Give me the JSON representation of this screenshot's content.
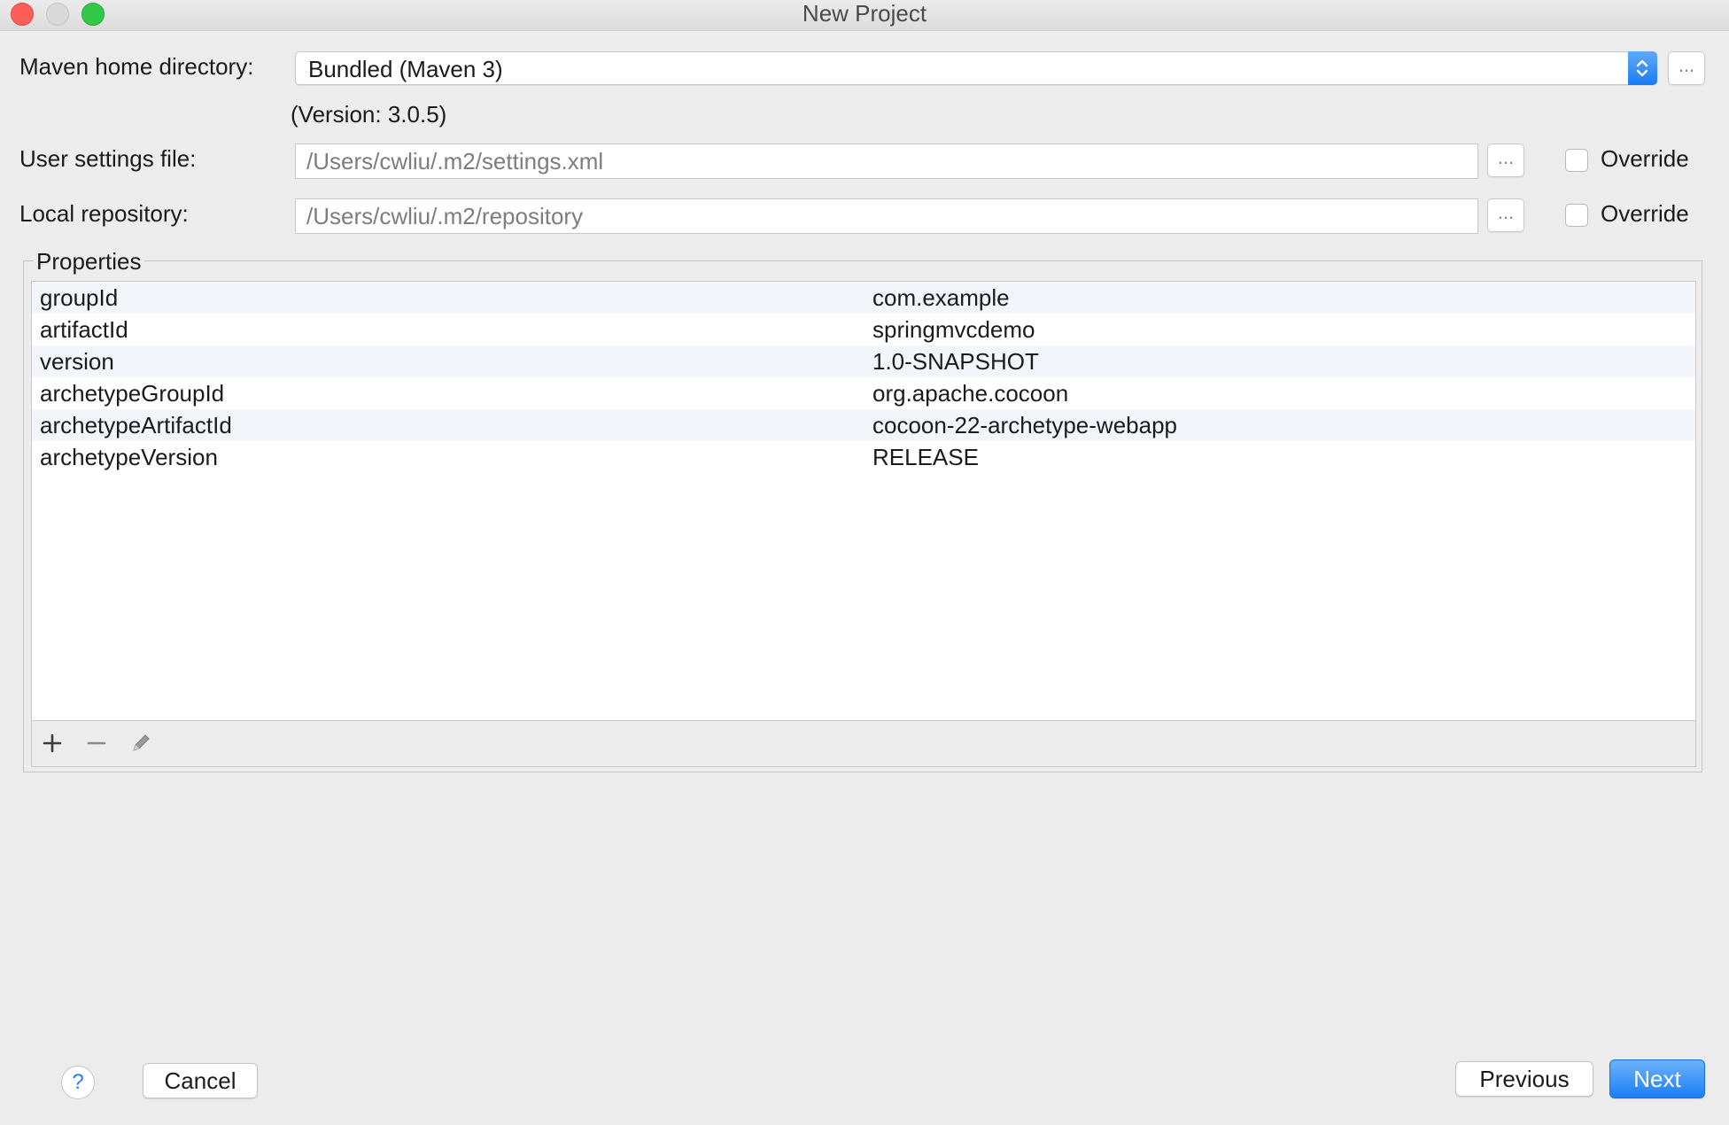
{
  "window": {
    "title": "New Project",
    "controls": [
      "close",
      "minimize",
      "zoom"
    ]
  },
  "maven": {
    "home_label": "Maven home directory:",
    "home_value": "Bundled (Maven 3)",
    "version_text": "(Version: 3.0.5)",
    "browse_label": "..."
  },
  "user_settings": {
    "label": "User settings file:",
    "value": "/Users/cwliu/.m2/settings.xml",
    "browse_label": "...",
    "override_label": "Override",
    "override_checked": false
  },
  "local_repository": {
    "label": "Local repository:",
    "value": "/Users/cwliu/.m2/repository",
    "browse_label": "...",
    "override_label": "Override",
    "override_checked": false
  },
  "properties": {
    "legend": "Properties",
    "rows": [
      {
        "key": "groupId",
        "value": "com.example"
      },
      {
        "key": "artifactId",
        "value": "springmvcdemo"
      },
      {
        "key": "version",
        "value": "1.0-SNAPSHOT"
      },
      {
        "key": "archetypeGroupId",
        "value": "org.apache.cocoon"
      },
      {
        "key": "archetypeArtifactId",
        "value": "cocoon-22-archetype-webapp"
      },
      {
        "key": "archetypeVersion",
        "value": "RELEASE"
      }
    ],
    "toolbar": [
      "add-icon",
      "remove-icon",
      "edit-icon"
    ]
  },
  "footer": {
    "help_label": "?",
    "cancel_label": "Cancel",
    "previous_label": "Previous",
    "next_label": "Next"
  },
  "colors": {
    "accent": "#1b7ef5",
    "background": "#ececec",
    "row_alt": "#f2f5f9"
  }
}
